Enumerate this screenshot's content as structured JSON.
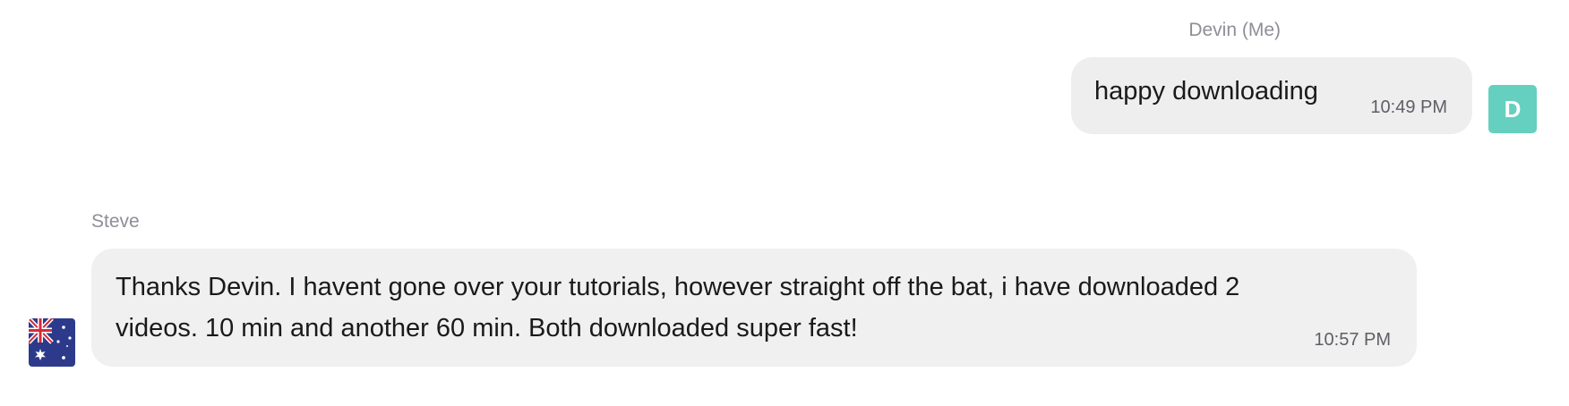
{
  "messages": [
    {
      "sender": "Devin (Me)",
      "text": "happy downloading",
      "time": "10:49 PM",
      "avatar_initial": "D",
      "avatar_color": "#66d0c0"
    },
    {
      "sender": "Steve",
      "text": "Thanks Devin. I havent gone over your tutorials, however straight off the bat, i have downloaded 2 videos. 10 min and another 60 min. Both downloaded super fast!",
      "time": "10:57 PM",
      "avatar_icon": "australia-flag-icon"
    }
  ],
  "colors": {
    "bubble_me": "#eeeeef",
    "bubble_other": "#f0f0f0",
    "sender_name": "#8e8e96",
    "timestamp": "#5e5e66",
    "flag_blue": "#2d3a8c",
    "flag_red": "#d62a3a"
  }
}
